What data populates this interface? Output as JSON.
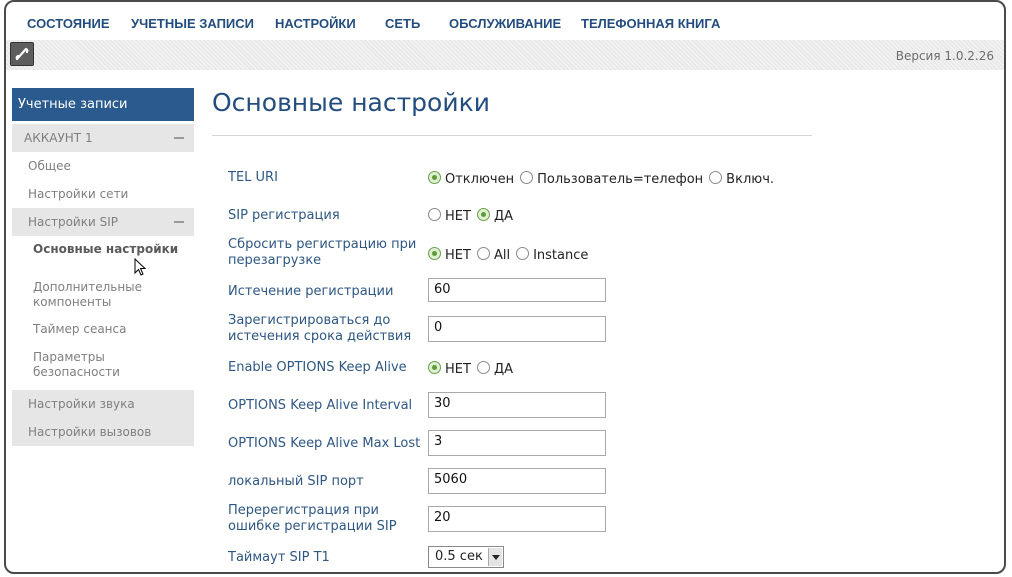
{
  "nav": {
    "items": [
      "СОСТОЯНИЕ",
      "УЧЕТНЫЕ ЗАПИСИ",
      "НАСТРОЙКИ",
      "СЕТЬ",
      "ОБСЛУЖИВАНИЕ",
      "ТЕЛЕФОННАЯ КНИГА"
    ]
  },
  "header": {
    "version": "Версия 1.0.2.26"
  },
  "sidebar": {
    "title": "Учетные записи",
    "account": "АККАУНТ 1",
    "general": "Общее",
    "network": "Настройки сети",
    "sip": "Настройки SIP",
    "sub": [
      "Основные настройки",
      "Дополнительные компоненты",
      "Таймер сеанса",
      "Параметры безопасности"
    ],
    "audio": "Настройки звука",
    "calls": "Настройки вызовов"
  },
  "page": {
    "title": "Основные настройки"
  },
  "form": {
    "tel_uri": {
      "label": "TEL URI",
      "options": [
        "Отключен",
        "Пользователь=телефон",
        "Включ."
      ],
      "selected": "Отключен"
    },
    "sip_reg": {
      "label": "SIP регистрация",
      "options": [
        "НЕТ",
        "ДА"
      ],
      "selected": "ДА"
    },
    "reset_reg": {
      "label": "Сбросить регистрацию при перезагрузке",
      "options": [
        "НЕТ",
        "All",
        "Instance"
      ],
      "selected": "НЕТ"
    },
    "reg_expire": {
      "label": "Истечение регистрации",
      "value": "60"
    },
    "reg_before": {
      "label": "Зарегистрироваться до истечения срока действия",
      "value": "0"
    },
    "options_ka": {
      "label": "Enable OPTIONS Keep Alive",
      "options": [
        "НЕТ",
        "ДА"
      ],
      "selected": "НЕТ"
    },
    "ka_interval": {
      "label": "OPTIONS Keep Alive Interval",
      "value": "30"
    },
    "ka_max_lost": {
      "label": "OPTIONS Keep Alive Max Lost",
      "value": "3"
    },
    "local_port": {
      "label": "локальный SIP порт",
      "value": "5060"
    },
    "rereg_fail": {
      "label": "Перерегистрация при ошибке регистрации SIP",
      "value": "20"
    },
    "sip_t1": {
      "label": "Таймаут SIP T1",
      "value": "0.5 сек"
    }
  },
  "colors": {
    "nav": "#244d7f",
    "sidebar_active": "#2b5a8f",
    "radio_checked": "#5f9a3b"
  }
}
